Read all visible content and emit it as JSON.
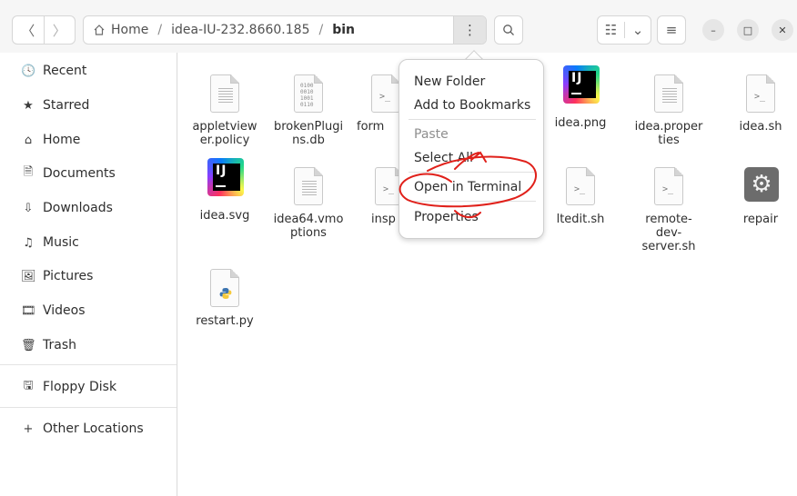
{
  "nav": {
    "back_icon": "chevron-left-icon",
    "forward_icon": "chevron-right-icon"
  },
  "path": {
    "home_label": "Home",
    "folder_label": "idea-IU-232.8660.185",
    "current_label": "bin",
    "separator": "/"
  },
  "toolbar": {
    "path_menu_glyph": "⋮",
    "search_glyph": "🔍",
    "view_list_glyph": "☷",
    "view_dropdown_glyph": "⌄",
    "main_menu_glyph": "≡",
    "minimize_glyph": "–",
    "maximize_glyph": "□",
    "close_glyph": "✕"
  },
  "sidebar": {
    "items": [
      {
        "label": "Recent",
        "glyph": "🕓",
        "icon": "recent-icon"
      },
      {
        "label": "Starred",
        "glyph": "★",
        "icon": "star-icon"
      },
      {
        "label": "Home",
        "glyph": "⌂",
        "icon": "home-icon"
      },
      {
        "label": "Documents",
        "glyph": "🗎",
        "icon": "documents-icon"
      },
      {
        "label": "Downloads",
        "glyph": "⇩",
        "icon": "downloads-icon"
      },
      {
        "label": "Music",
        "glyph": "♫",
        "icon": "music-icon"
      },
      {
        "label": "Pictures",
        "glyph": "🖼",
        "icon": "pictures-icon"
      },
      {
        "label": "Videos",
        "glyph": "🎞",
        "icon": "videos-icon"
      },
      {
        "label": "Trash",
        "glyph": "🗑",
        "icon": "trash-icon"
      },
      {
        "label": "Floppy Disk",
        "glyph": "🖫",
        "icon": "floppy-disk-icon"
      },
      {
        "label": "Other Locations",
        "glyph": "+",
        "icon": "plus-icon"
      }
    ]
  },
  "files": [
    {
      "name": "appletviewer.policy",
      "kind": "text"
    },
    {
      "name": "brokenPlugins.db",
      "kind": "binary",
      "bin_text": "0100\n0010\n1001\n0110"
    },
    {
      "name": "form",
      "kind": "script"
    },
    {
      "name": "idea.png",
      "kind": "ij"
    },
    {
      "name": "idea.properties",
      "kind": "text"
    },
    {
      "name": "idea.sh",
      "kind": "script"
    },
    {
      "name": "idea.svg",
      "kind": "ij"
    },
    {
      "name": "idea64.vmoptions",
      "kind": "text"
    },
    {
      "name": "insp",
      "kind": "script"
    },
    {
      "name": "ltedit.sh",
      "kind": "script"
    },
    {
      "name": "remote-dev-server.sh",
      "kind": "script"
    },
    {
      "name": "repair",
      "kind": "exec"
    },
    {
      "name": "restart.py",
      "kind": "python"
    }
  ],
  "ij_text": "IJ",
  "prompt_text": ">_",
  "context_menu": {
    "new_folder": "New Folder",
    "add_bookmarks": "Add to Bookmarks",
    "paste": "Paste",
    "select_all": "Select All",
    "open_terminal": "Open in Terminal",
    "properties": "Properties"
  },
  "colors": {
    "annotation": "#e0201a",
    "accent": "#e95420"
  }
}
